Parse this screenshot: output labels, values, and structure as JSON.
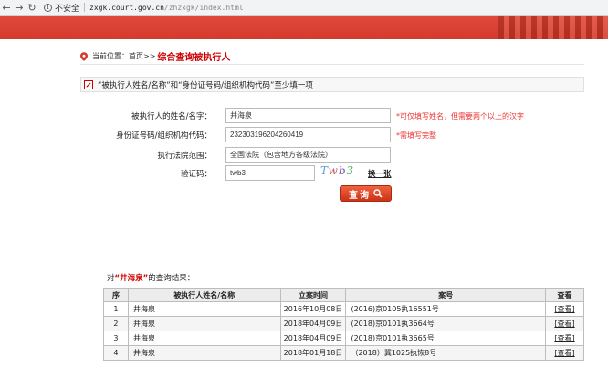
{
  "browser": {
    "insecure_label": "不安全",
    "url_host": "zxgk.court.gov.cn",
    "url_path": "/zhzxgk/index.html"
  },
  "breadcrumb": {
    "label": "当前位置：首页>>",
    "current": "综合查询被执行人"
  },
  "notice": {
    "text": "“被执行人姓名/名称”和“身份证号码/组织机构代码”至少填一项"
  },
  "form": {
    "name_label": "被执行人的姓名/名字：",
    "name_value": "井海泉",
    "name_hint": "*可仅填写姓名，但需要两个以上的汉字",
    "id_label": "身份证号码/组织机构代码：",
    "id_value": "232303196204260419",
    "id_hint": "*需填写完整",
    "court_label": "执行法院范围：",
    "court_value": "全国法院（包含地方各级法院）",
    "captcha_label": "验证码：",
    "captcha_value": "twb3",
    "captcha_image_text": "Twb3",
    "refresh_label": "换一张",
    "query_label": "查询"
  },
  "results": {
    "title_prefix": "对",
    "title_name": "“井海泉”",
    "title_suffix": "的查询结果：",
    "columns": [
      "序",
      "被执行人姓名/名称",
      "立案时间",
      "案号",
      "查看"
    ],
    "rows": [
      {
        "no": "1",
        "name": "井海泉",
        "date": "2016年10月08日",
        "case": "(2016)京0105执16551号",
        "view": "[查看]"
      },
      {
        "no": "2",
        "name": "井海泉",
        "date": "2018年04月09日",
        "case": "(2018)京0101执3664号",
        "view": "[查看]"
      },
      {
        "no": "3",
        "name": "井海泉",
        "date": "2018年04月09日",
        "case": "(2018)京0101执3665号",
        "view": "[查看]"
      },
      {
        "no": "4",
        "name": "井海泉",
        "date": "2018年01月18日",
        "case": "（2018）冀1025执恢8号",
        "view": "[查看]"
      }
    ]
  },
  "colors": {
    "brand_red": "#d23a2c",
    "hint_red": "#e33333",
    "title_red": "#cc0000"
  }
}
